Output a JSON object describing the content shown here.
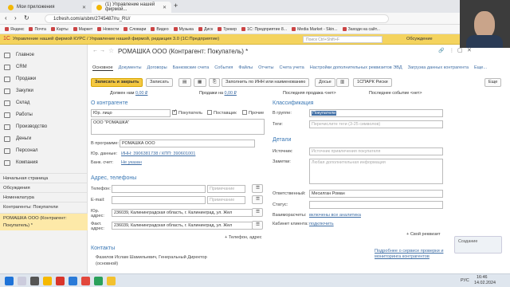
{
  "browser": {
    "tabs": [
      {
        "title": "Мои приложения"
      },
      {
        "title": "(1) Управление нашей фирмой..."
      }
    ],
    "url": "1cfresh.com/a/sbm/2745487/ru_RU/",
    "bookmarks": [
      "Яндекс",
      "Почта",
      "Карты",
      "Маркет",
      "Новости",
      "Словари",
      "Видео",
      "Музыка",
      "Диск",
      "Трекер",
      "1С: Предприятие 8...",
      "Media Market - Skin...",
      "Заходи на сайт..."
    ]
  },
  "app": {
    "header": "Управление нашей фирмой КУРС / Управление нашей фирмой, редакция 3.0 (1С:Предприятие)",
    "search_placeholder": "Поиск Ctrl+Shift+F",
    "discussion": "Обсуждение"
  },
  "sidebar": {
    "items": [
      {
        "label": "Главное"
      },
      {
        "label": "CRM"
      },
      {
        "label": "Продажи"
      },
      {
        "label": "Закупки"
      },
      {
        "label": "Склад"
      },
      {
        "label": "Работы"
      },
      {
        "label": "Производство"
      },
      {
        "label": "Деньги"
      },
      {
        "label": "Персонал"
      },
      {
        "label": "Компания"
      }
    ],
    "nav": [
      {
        "label": "Начальная страница"
      },
      {
        "label": "Обсуждения"
      },
      {
        "label": "Номенклатура"
      },
      {
        "label": "Контрагенты: Покупатели"
      },
      {
        "label": "РОМАШКА ООО (Контрагент: Покупатель) *"
      }
    ]
  },
  "form": {
    "title": "РОМАШКА ООО (Контрагент: Покупатель) *",
    "tabs": [
      "Основное",
      "Документы",
      "Договоры",
      "Банковские счета",
      "События",
      "Файлы",
      "Отчеты",
      "Счета учета",
      "Настройки дополнительных реквизитов ЭВД",
      "Загрузка данных контрагента",
      "Еще..."
    ],
    "buttons": {
      "save_close": "Записать и закрыть",
      "save": "Записать",
      "fill_inn": "Заполнить по ИНН или наименованию",
      "dossier": "Досье",
      "spark": "1СПАРК Риски",
      "more": "Еще"
    },
    "stats": {
      "owes": "Должен нам",
      "owes_val": "0,00 ₽",
      "sales": "Продажи на",
      "sales_val": "0,00 ₽",
      "last_sale": "Последняя продажа <нет>",
      "last_event": "Последнее событие <нет>"
    },
    "about": {
      "heading": "О контрагенте",
      "type": "Юр. лицо",
      "buyer": "Покупатель",
      "supplier": "Поставщик",
      "other": "Прочие",
      "name": "ООО \"РОМАШКА\"",
      "in_programs_label": "В программе:",
      "in_programs": "РОМАШКА ООО",
      "legal_label": "Юр. данные:",
      "legal": "ИНН: 3906381738 / КПП: 390601001",
      "bank_label": "Банк. счет:",
      "bank": "Не указан"
    },
    "address": {
      "heading": "Адрес, телефоны",
      "phone_label": "Телефон:",
      "email_label": "E-mail:",
      "note": "Примечание",
      "legal_label": "Юр. адрес:",
      "legal": "236039, Калининградская область, г. Калининград, ул. Жел",
      "actual_label": "Факт. адрес:",
      "actual": "236039, Калининградская область, г. Калининград, ул. Жел",
      "add": "+ Телефон, адрес"
    },
    "contacts": {
      "heading": "Контакты",
      "person": "Фазилов Ислам Шамильевич, Генеральный Директор",
      "role": "(основной)"
    },
    "class": {
      "heading": "Классификация",
      "group_label": "В группе:",
      "group": "Покупатели",
      "tags_label": "Теги:",
      "tags_ph": "Перечислите теги (3-25 символов)"
    },
    "details": {
      "heading": "Детали",
      "source_label": "Источник:",
      "source_ph": "Источник привлечения покупателя",
      "notes_label": "Заметки:",
      "notes_ph": "Любая дополнительная информация",
      "resp_label": "Ответственный:",
      "resp": "Месилган Роман",
      "status_label": "Статус:",
      "mutual_label": "Взаиморасчеты:",
      "mutual": "включены все аналитика",
      "cabinet_label": "Кабинет клиента:",
      "cabinet": "подключить",
      "own_req": "+ Свой реквизит"
    },
    "promo": {
      "text": "Подробнее о сервисе проверки и мониторинга контрагентов",
      "badge": "Создание"
    }
  },
  "taskbar": {
    "time": "16:46",
    "date": "14.02.2024",
    "lang": "РУС"
  }
}
